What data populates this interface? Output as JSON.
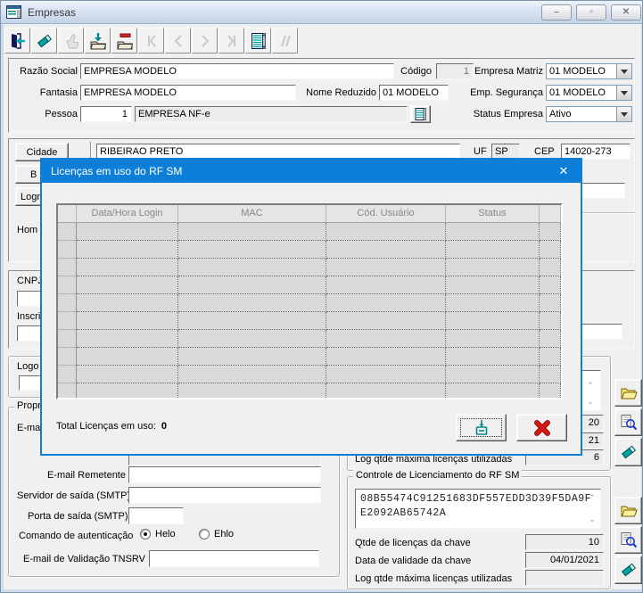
{
  "window": {
    "title": "Empresas",
    "minimize": "–",
    "maximize": "▫",
    "close": "✕"
  },
  "toolbar": {
    "icons": [
      "exit-icon",
      "erase-icon",
      "confirm-icon",
      "save-folder-icon",
      "delete-folder-icon",
      "nav-first-icon",
      "nav-prior-icon",
      "nav-next-icon",
      "nav-last-icon",
      "grid-icon",
      "filter-icon"
    ]
  },
  "form": {
    "razao_social_label": "Razão Social",
    "razao_social_value": "EMPRESA MODELO",
    "codigo_label": "Código",
    "codigo_value": "1",
    "empresa_matriz_label": "Empresa Matriz",
    "empresa_matriz_value": "01 MODELO",
    "fantasia_label": "Fantasia",
    "fantasia_value": "EMPRESA MODELO",
    "nome_reduzido_label": "Nome Reduzido",
    "nome_reduzido_value": "01 MODELO",
    "emp_seguranca_label": "Emp. Segurança",
    "emp_seguranca_value": "01 MODELO",
    "pessoa_label": "Pessoa",
    "pessoa_codigo": "1",
    "pessoa_nome": "EMPRESA NF-e",
    "status_empresa_label": "Status Empresa",
    "status_empresa_value": "Ativo",
    "cidade_button": "Cidade",
    "cidade_value": "RIBEIRAO PRETO",
    "uf_label": "UF",
    "uf_value": "SP",
    "cep_label": "CEP",
    "cep_value": "14020-273",
    "bairro_button_visible": "B",
    "logradouro_button_visible": "Logr",
    "homepage_label_visible": "Hom",
    "cnpj_label_visible": "CNPJ",
    "inscricao_label_visible": "Inscri",
    "logo_label_visible": "Logo",
    "propriedades_caption_visible": "Propri",
    "email_label_visible": "E-ma",
    "email_remetente_label": "E-mail Remetente",
    "email_remetente_value": "",
    "servidor_saida_label": "Servidor de saída (SMTP)",
    "servidor_saida_value": "",
    "porta_saida_label": "Porta de saída (SMTP)",
    "porta_saida_value": "",
    "comando_aut_label": "Comando de autenticação",
    "radio_helo": "Helo",
    "radio_ehlo": "Ehlo",
    "email_validacao_label": "E-mail de Validação TNSRV",
    "email_validacao_value": ""
  },
  "right_column": {
    "hidden_field_value_1": "20",
    "hidden_field_value_2": "21",
    "log_qtde_label": "Log qtde máxima licenças utilizadas",
    "log_qtde_value": "6"
  },
  "licenciamento": {
    "caption": "Controle de Licenciamento do RF SM",
    "chave_line1": "08B55474C91251683DF557EDD3D39F5DA9F",
    "chave_line2": "E2092AB65742A",
    "qtde_label": "Qtde de licenças da chave",
    "qtde_value": "10",
    "validade_label": "Data de validade da chave",
    "validade_value": "04/01/2021",
    "log_label": "Log qtde máxima licenças utilizadas",
    "log_value": ""
  },
  "dialog": {
    "title": "Licenças em uso do RF SM",
    "table": {
      "columns": [
        "",
        "Data/Hora Login",
        "MAC",
        "Cód. Usuário",
        "Status",
        ""
      ],
      "row_count": 10,
      "rows": []
    },
    "total_label": "Total Licenças em uso:",
    "total_value": "0"
  },
  "colors": {
    "dialog_accent": "#0e7fd8",
    "icon_teal": "#008a8a",
    "cancel_red": "#d41616",
    "titlebar_blue": "#c3d3e7"
  }
}
